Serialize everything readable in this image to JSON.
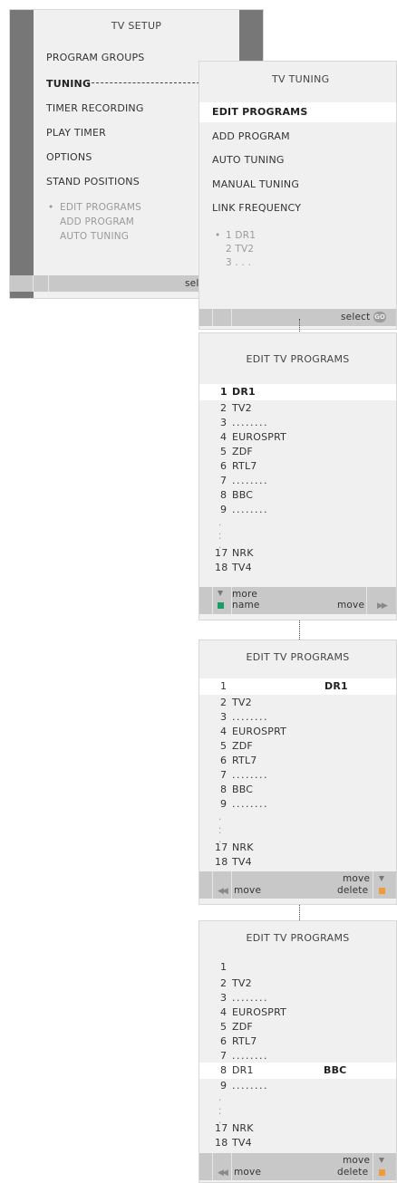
{
  "tv_setup": {
    "title": "TV SETUP",
    "items": [
      "PROGRAM GROUPS",
      "TUNING",
      "TIMER RECORDING",
      "PLAY TIMER",
      "OPTIONS",
      "STAND POSITIONS"
    ],
    "submenu": [
      "EDIT PROGRAMS",
      "ADD PROGRAM",
      "AUTO TUNING"
    ],
    "select_label": "select"
  },
  "tv_tuning": {
    "title": "TV TUNING",
    "items": [
      "EDIT PROGRAMS",
      "ADD PROGRAM",
      "AUTO TUNING",
      "MANUAL TUNING",
      "LINK FREQUENCY"
    ],
    "preview": [
      "1 DR1",
      "2 TV2",
      "3 . . ."
    ],
    "select_label": "select",
    "go_icon_text": "GO"
  },
  "edit1": {
    "title": "EDIT TV PROGRAMS",
    "rows": [
      {
        "num": "1",
        "name": "DR1"
      },
      {
        "num": "2",
        "name": "TV2"
      },
      {
        "num": "3",
        "name": ". . . . . . . ."
      },
      {
        "num": "4",
        "name": "EUROSPRT"
      },
      {
        "num": "5",
        "name": "ZDF"
      },
      {
        "num": "6",
        "name": "RTL7"
      },
      {
        "num": "7",
        "name": ". . . . . . . ."
      },
      {
        "num": "8",
        "name": "BBC"
      },
      {
        "num": "9",
        "name": ". . . . . . . ."
      },
      {
        "num": "17",
        "name": "NRK"
      },
      {
        "num": "18",
        "name": "TV4"
      }
    ],
    "more_label": "more",
    "name_label": "name",
    "move_label": "move"
  },
  "edit2": {
    "title": "EDIT TV PROGRAMS",
    "moving_name": "DR1",
    "rows": [
      {
        "num": "1",
        "name": ""
      },
      {
        "num": "2",
        "name": "TV2"
      },
      {
        "num": "3",
        "name": ". . . . . . . ."
      },
      {
        "num": "4",
        "name": "EUROSPRT"
      },
      {
        "num": "5",
        "name": "ZDF"
      },
      {
        "num": "6",
        "name": "RTL7"
      },
      {
        "num": "7",
        "name": ". . . . . . . ."
      },
      {
        "num": "8",
        "name": "BBC"
      },
      {
        "num": "9",
        "name": ". . . . . . . ."
      },
      {
        "num": "17",
        "name": "NRK"
      },
      {
        "num": "18",
        "name": "TV4"
      }
    ],
    "move_left_label": "move",
    "move_right_label": "move",
    "delete_label": "delete"
  },
  "edit3": {
    "title": "EDIT TV PROGRAMS",
    "moving_name": "BBC",
    "rows": [
      {
        "num": "1",
        "name": ""
      },
      {
        "num": "2",
        "name": "TV2"
      },
      {
        "num": "3",
        "name": ". . . . . . . ."
      },
      {
        "num": "4",
        "name": "EUROSPRT"
      },
      {
        "num": "5",
        "name": "ZDF"
      },
      {
        "num": "6",
        "name": "RTL7"
      },
      {
        "num": "7",
        "name": ". . . . . . . ."
      },
      {
        "num": "8",
        "name": "DR1"
      },
      {
        "num": "9",
        "name": ". . . . . . . ."
      },
      {
        "num": "17",
        "name": "NRK"
      },
      {
        "num": "18",
        "name": "TV4"
      }
    ],
    "move_left_label": "move",
    "move_right_label": "move",
    "delete_label": "delete"
  },
  "colors": {
    "menu_bg": "#f0f0f0",
    "side_band": "#777777",
    "bar": "#c8c8c8",
    "highlight": "#ffffff",
    "green_button": "#1a9b6a",
    "orange_button": "#f29a3a"
  }
}
